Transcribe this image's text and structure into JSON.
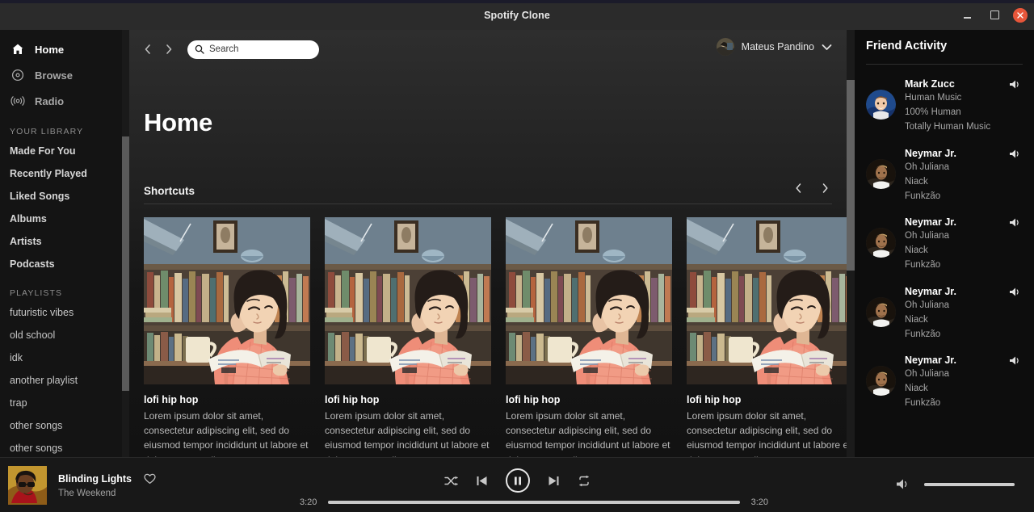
{
  "window": {
    "title": "Spotify Clone",
    "minimize_label": "Minimize",
    "maximize_label": "Maximize",
    "close_label": "Close"
  },
  "sidebar": {
    "nav": [
      {
        "label": "Home",
        "icon": "home-icon",
        "active": true
      },
      {
        "label": "Browse",
        "icon": "browse-icon",
        "active": false
      },
      {
        "label": "Radio",
        "icon": "radio-icon",
        "active": false
      }
    ],
    "library_heading": "YOUR LIBRARY",
    "library": [
      {
        "label": "Made For You"
      },
      {
        "label": "Recently Played"
      },
      {
        "label": "Liked Songs"
      },
      {
        "label": "Albums"
      },
      {
        "label": "Artists"
      },
      {
        "label": "Podcasts"
      }
    ],
    "playlists_heading": "PLAYLISTS",
    "playlists": [
      {
        "label": "futuristic vibes"
      },
      {
        "label": "old school"
      },
      {
        "label": "idk"
      },
      {
        "label": "another playlist"
      },
      {
        "label": "trap"
      },
      {
        "label": "other songs"
      },
      {
        "label": "other songs"
      }
    ]
  },
  "topbar": {
    "back_label": "Back",
    "forward_label": "Forward",
    "search_placeholder": "Search",
    "search_value": "",
    "profile_name": "Mateus Pandino"
  },
  "main": {
    "page_title": "Home",
    "section": {
      "title": "Shortcuts",
      "prev_label": "Previous",
      "next_label": "Next"
    },
    "cards": [
      {
        "title": "lofi hip hop",
        "description": "Lorem ipsum dolor sit amet, consectetur adipiscing elit, sed do eiusmod tempor incididunt ut labore et dolore magna aliqua."
      },
      {
        "title": "lofi hip hop",
        "description": "Lorem ipsum dolor sit amet, consectetur adipiscing elit, sed do eiusmod tempor incididunt ut labore et dolore magna aliqua."
      },
      {
        "title": "lofi hip hop",
        "description": "Lorem ipsum dolor sit amet, consectetur adipiscing elit, sed do eiusmod tempor incididunt ut labore et dolore magna aliqua."
      },
      {
        "title": "lofi hip hop",
        "description": "Lorem ipsum dolor sit amet, consectetur adipiscing elit, sed do eiusmod tempor incididunt ut labore et dolore magna aliqua."
      }
    ]
  },
  "friend_activity": {
    "title": "Friend Activity",
    "friends": [
      {
        "name": "Mark Zucc",
        "track": "Human Music",
        "artist": "100% Human",
        "context": "Totally Human Music",
        "avatar": "mark-zucc-avatar"
      },
      {
        "name": "Neymar Jr.",
        "track": "Oh Juliana",
        "artist": "Niack",
        "context": "Funkzão",
        "avatar": "neymar-avatar"
      },
      {
        "name": "Neymar Jr.",
        "track": "Oh Juliana",
        "artist": "Niack",
        "context": "Funkzão",
        "avatar": "neymar-avatar"
      },
      {
        "name": "Neymar Jr.",
        "track": "Oh Juliana",
        "artist": "Niack",
        "context": "Funkzão",
        "avatar": "neymar-avatar"
      },
      {
        "name": "Neymar Jr.",
        "track": "Oh Juliana",
        "artist": "Niack",
        "context": "Funkzão",
        "avatar": "neymar-avatar"
      }
    ]
  },
  "player": {
    "track_title": "Blinding Lights",
    "track_artist": "The Weekend",
    "like_label": "Like",
    "shuffle_label": "Shuffle",
    "previous_label": "Previous track",
    "play_pause_label": "Pause",
    "next_label": "Next track",
    "repeat_label": "Repeat",
    "elapsed_time": "3:20",
    "total_time": "3:20",
    "progress_percent": 100,
    "volume_percent": 100,
    "volume_label": "Volume"
  },
  "colors": {
    "accent": "#1db954",
    "close_button": "#e8563a",
    "app_background": "#121212",
    "sidebar_background": "#141414",
    "panel_background": "#0d0d0d"
  }
}
